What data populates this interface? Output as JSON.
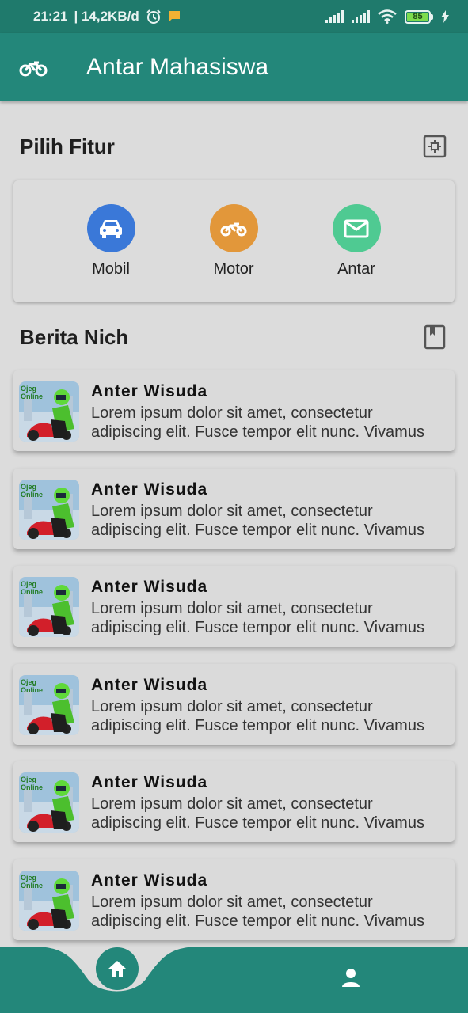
{
  "status_bar": {
    "time": "21:21",
    "network_speed": "| 14,2KB/d",
    "battery_level": "85"
  },
  "app_bar": {
    "title": "Antar Mahasiswa"
  },
  "features_section": {
    "title": "Pilih Fitur",
    "items": [
      {
        "label": "Mobil",
        "icon": "car-icon",
        "color": "#3a78d8"
      },
      {
        "label": "Motor",
        "icon": "motorcycle-icon",
        "color": "#e2973a"
      },
      {
        "label": "Antar",
        "icon": "mail-icon",
        "color": "#4fca92"
      }
    ]
  },
  "news_section": {
    "title": "Berita Nich",
    "items": [
      {
        "title": "Anter Wisuda",
        "body": "Lorem ipsum dolor sit amet, consectetur adipiscing elit. Fusce tempor elit nunc. Vivamus"
      },
      {
        "title": "Anter Wisuda",
        "body": "Lorem ipsum dolor sit amet, consectetur adipiscing elit. Fusce tempor elit nunc. Vivamus"
      },
      {
        "title": "Anter Wisuda",
        "body": "Lorem ipsum dolor sit amet, consectetur adipiscing elit. Fusce tempor elit nunc. Vivamus"
      },
      {
        "title": "Anter Wisuda",
        "body": "Lorem ipsum dolor sit amet, consectetur adipiscing elit. Fusce tempor elit nunc. Vivamus"
      },
      {
        "title": "Anter Wisuda",
        "body": "Lorem ipsum dolor sit amet, consectetur adipiscing elit. Fusce tempor elit nunc. Vivamus"
      },
      {
        "title": "Anter Wisuda",
        "body": "Lorem ipsum dolor sit amet, consectetur adipiscing elit. Fusce tempor elit nunc. Vivamus"
      }
    ],
    "thumbnail_text": "Ojeg Online"
  },
  "colors": {
    "primary": "#23877a",
    "status_bar": "#1f7a6c",
    "background": "#dcdcdc"
  }
}
